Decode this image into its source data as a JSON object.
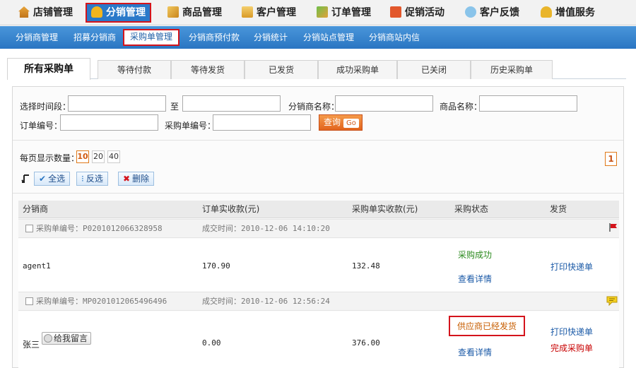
{
  "top_nav": {
    "items": [
      {
        "label": "店铺管理",
        "icon": "house-icon"
      },
      {
        "label": "分销管理",
        "icon": "people-icon",
        "active": true
      },
      {
        "label": "商品管理",
        "icon": "box-icon"
      },
      {
        "label": "客户管理",
        "icon": "card-icon"
      },
      {
        "label": "订单管理",
        "icon": "order-icon"
      },
      {
        "label": "促销活动",
        "icon": "promo-icon"
      },
      {
        "label": "客户反馈",
        "icon": "bubble-icon"
      },
      {
        "label": "增值服务",
        "icon": "rich-icon"
      }
    ]
  },
  "sub_nav": {
    "items": [
      "分销商管理",
      "招募分销商",
      "采购单管理",
      "分销商预付款",
      "分销统计",
      "分销站点管理",
      "分销商站内信"
    ],
    "active_index": 2
  },
  "tabs": [
    "所有采购单",
    "等待付款",
    "等待发货",
    "已发货",
    "成功采购单",
    "已关闭",
    "历史采购单"
  ],
  "filters": {
    "time_label": "选择时间段：",
    "to_label": "至",
    "distributor_label": "分销商名称：",
    "product_label": "商品名称：",
    "order_no_label": "订单编号：",
    "po_no_label": "采购单编号：",
    "query_button": "查询",
    "go_label": "Go",
    "time_from": "",
    "time_to": "",
    "distributor": "",
    "product": "",
    "order_no": "",
    "po_no": ""
  },
  "per_page": {
    "label": "每页显示数量：",
    "options": [
      "10",
      "20",
      "40"
    ],
    "selected": "10"
  },
  "pagination": {
    "current": "1"
  },
  "actions": {
    "select_all": "全选",
    "invert": "反选",
    "delete": "删除"
  },
  "table": {
    "headers": [
      "分销商",
      "订单实收款(元)",
      "采购单实收款(元)",
      "采购状态",
      "发货"
    ],
    "orders": [
      {
        "po_label": "采购单编号：",
        "po_no": "P0201012066328958",
        "time_label": "成交时间：",
        "time": "2010-12-06 14:10:20",
        "distributor": "agent1",
        "order_amount": "170.90",
        "po_amount": "132.48",
        "status": "采购成功",
        "detail": "查看详情",
        "ship_actions": [
          "打印快递单"
        ],
        "marker_icon": "red-flag-icon"
      },
      {
        "po_label": "采购单编号：",
        "po_no": "MP0201012065496496",
        "time_label": "成交时间：",
        "time": "2010-12-06 12:56:24",
        "distributor": "张三",
        "message_button": "给我留言",
        "order_amount": "0.00",
        "po_amount": "376.00",
        "status": "供应商已经发货",
        "detail": "查看详情",
        "ship_actions": [
          "打印快递单",
          "完成采购单"
        ],
        "marker_icon": "comment-icon"
      }
    ]
  },
  "colors": {
    "accent_blue": "#2a75c2",
    "highlight_red": "#d4141c",
    "query_orange": "#e2641d",
    "status_green": "#2b8a1e",
    "status_orange": "#c75d00"
  }
}
